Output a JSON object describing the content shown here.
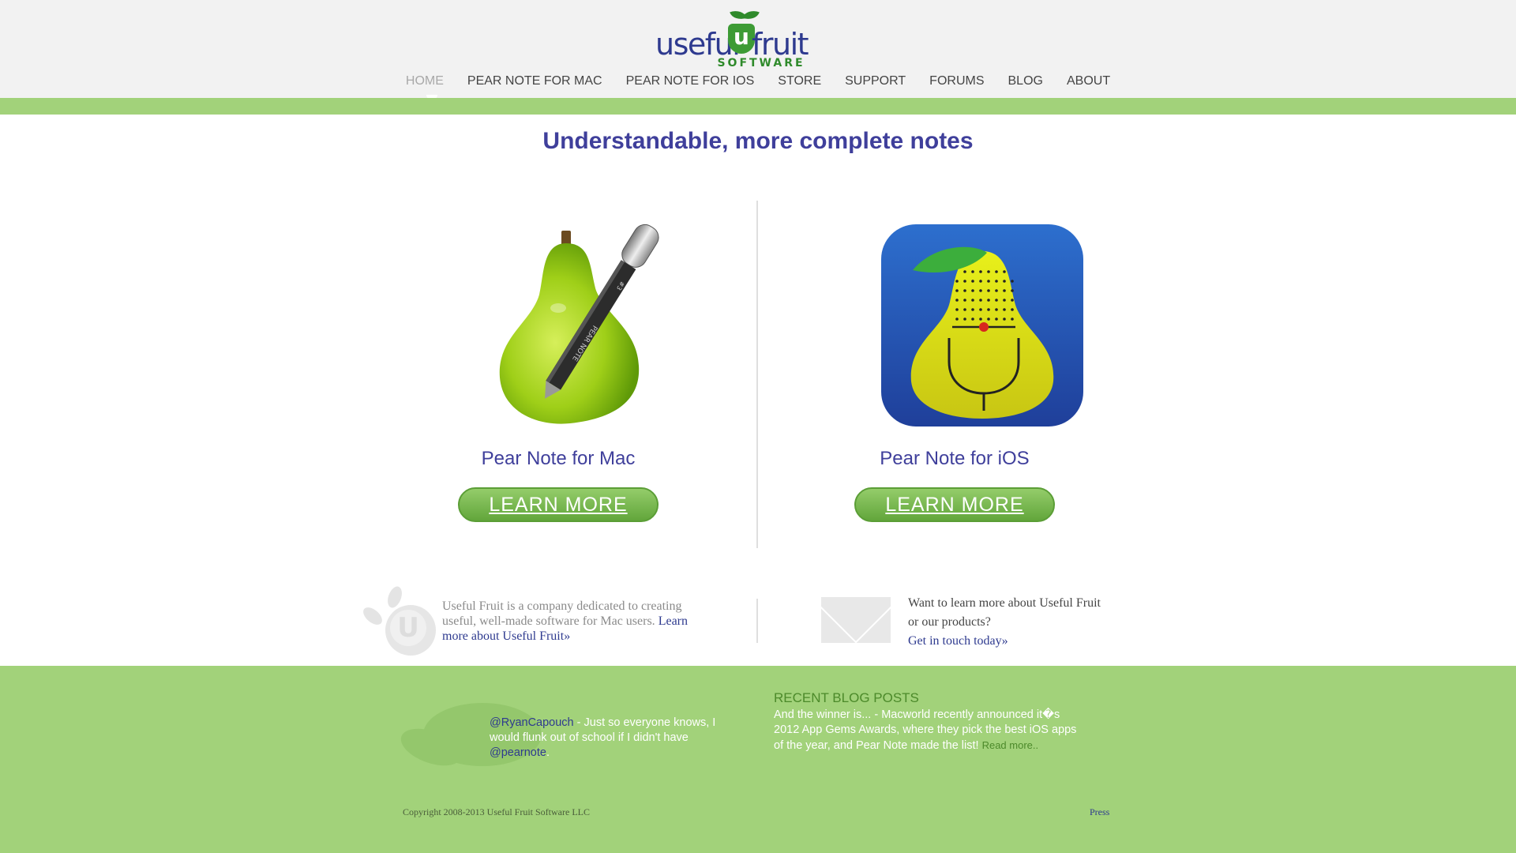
{
  "header": {
    "logo": {
      "word_left": "useful",
      "u_mark": "u",
      "word_right": "fruit",
      "sub": "SOFTWARE"
    },
    "nav": [
      {
        "label": "HOME",
        "active": true
      },
      {
        "label": "PEAR NOTE FOR MAC"
      },
      {
        "label": "PEAR NOTE FOR IOS"
      },
      {
        "label": "STORE"
      },
      {
        "label": "SUPPORT"
      },
      {
        "label": "FORUMS"
      },
      {
        "label": "BLOG"
      },
      {
        "label": "ABOUT"
      }
    ]
  },
  "main": {
    "title": "Understandable, more complete notes",
    "products": [
      {
        "name": "Pear Note for Mac",
        "button": "LEARN MORE",
        "icon_text": "PEAR NOTE",
        "icon_text2": "#3"
      },
      {
        "name": "Pear Note for iOS",
        "button": "LEARN MORE"
      }
    ]
  },
  "about": {
    "logo_letter": "U",
    "text": "Useful Fruit is a company dedicated to creating useful, well-made software for Mac users.",
    "link": "Learn more about Useful Fruit»"
  },
  "contact": {
    "text": "Want to learn more about Useful Fruit or our products?",
    "link": "Get in touch today»"
  },
  "footer": {
    "tweet": {
      "handle": "@RyanCapouch",
      "text": " - Just so everyone knows, I would flunk out of school if I didn't have ",
      "mention": "@pearnote",
      "end": "."
    },
    "blog": {
      "heading": "RECENT BLOG POSTS",
      "text": "And the winner is... - Macworld recently announced it�s 2012 App Gems Awards, where they pick the best iOS apps of the year, and Pear Note made the list!",
      "read_more": "Read more.."
    },
    "copyright": "Copyright 2008-2013 Useful Fruit Software LLC",
    "press": "Press"
  },
  "colors": {
    "accent_blue": "#3f3f9b",
    "brand_green": "#a2d27a",
    "button_green": "#6aad42"
  }
}
